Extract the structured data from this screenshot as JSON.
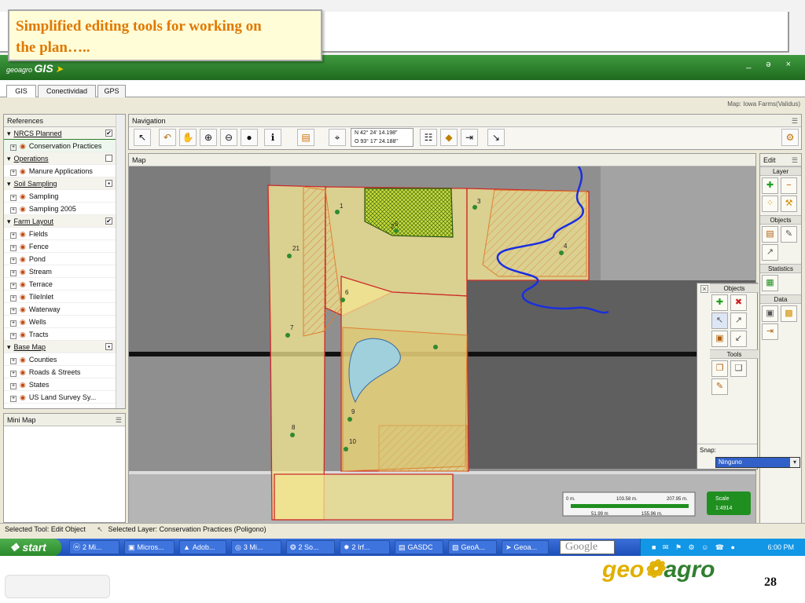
{
  "callout": {
    "line1": "Simplified editing tools for working on",
    "line2": "the plan….."
  },
  "app": {
    "brand_small": "geoagro",
    "brand_big": "GIS",
    "window_buttons": "_ ə ×",
    "tabs": [
      {
        "label": "GIS"
      },
      {
        "label": "Conectividad"
      },
      {
        "label": "GPS"
      }
    ],
    "map_label": "Map: Iowa Farms(Validus)"
  },
  "references": {
    "title": "References",
    "items": [
      {
        "type": "group",
        "label": "NRCS Planned",
        "checked": "✔"
      },
      {
        "type": "layer",
        "label": "Conservation Practices",
        "selected": true
      },
      {
        "type": "group",
        "label": "Operations",
        "checked": ""
      },
      {
        "type": "layer",
        "label": "Manure Applications"
      },
      {
        "type": "group",
        "label": "Soil Sampling",
        "checked": "▪"
      },
      {
        "type": "layer",
        "label": "Sampling"
      },
      {
        "type": "layer",
        "label": "Sampling 2005"
      },
      {
        "type": "group",
        "label": "Farm Layout",
        "checked": "✔"
      },
      {
        "type": "layer",
        "label": "Fields"
      },
      {
        "type": "layer",
        "label": "Fence"
      },
      {
        "type": "layer",
        "label": "Pond"
      },
      {
        "type": "layer",
        "label": "Stream"
      },
      {
        "type": "layer",
        "label": "Terrace"
      },
      {
        "type": "layer",
        "label": "TileInlet"
      },
      {
        "type": "layer",
        "label": "Waterway"
      },
      {
        "type": "layer",
        "label": "Wells"
      },
      {
        "type": "layer",
        "label": "Tracts"
      },
      {
        "type": "group",
        "label": "Base Map",
        "checked": "▪"
      },
      {
        "type": "layer",
        "label": "Counties"
      },
      {
        "type": "layer",
        "label": "Roads & Streets"
      },
      {
        "type": "layer",
        "label": "States"
      },
      {
        "type": "layer",
        "label": "US Land Survey Sy..."
      }
    ]
  },
  "minimap": {
    "title": "Mini Map"
  },
  "navigation": {
    "title": "Navigation",
    "coord_n": "N 42° 24' 14.198\"",
    "coord_o": "O 93° 17' 24.188\""
  },
  "map": {
    "title": "Map",
    "field_labels": [
      "1",
      "2",
      "3",
      "4",
      "5",
      "6",
      "7",
      "8",
      "9",
      "10",
      "21"
    ],
    "scale_ticks_top": [
      "0 m.",
      "103.58 m.",
      "207.95 m."
    ],
    "scale_ticks_bottom": [
      "51.99 m",
      "155.96 m."
    ],
    "scale_label": "Scale",
    "scale_value": "1:4914"
  },
  "edit_panel": {
    "title": "Edit",
    "layer_head": "Layer",
    "objects_head": "Objects",
    "statistics_head": "Statistics",
    "data_head": "Data"
  },
  "objects_panel": {
    "objects_head": "Objects",
    "tools_head": "Tools",
    "snap_label": "Snap:",
    "snap_value": "Ninguno"
  },
  "status": {
    "tool": "Selected Tool: Edit Object",
    "layer": "Selected Layer: Conservation Practices (Poligono)"
  },
  "taskbar": {
    "start": "start",
    "tasks": [
      "2 Mi...",
      "Micros...",
      "Adob...",
      "3 Mi...",
      "2 So...",
      "2 Irf...",
      "GASDC",
      "GeoA...",
      "Geoa..."
    ],
    "google": "Google",
    "time": "6:00 PM"
  },
  "footer": {
    "logo_left": "geo",
    "logo_right": "agro",
    "page_number": "28"
  }
}
